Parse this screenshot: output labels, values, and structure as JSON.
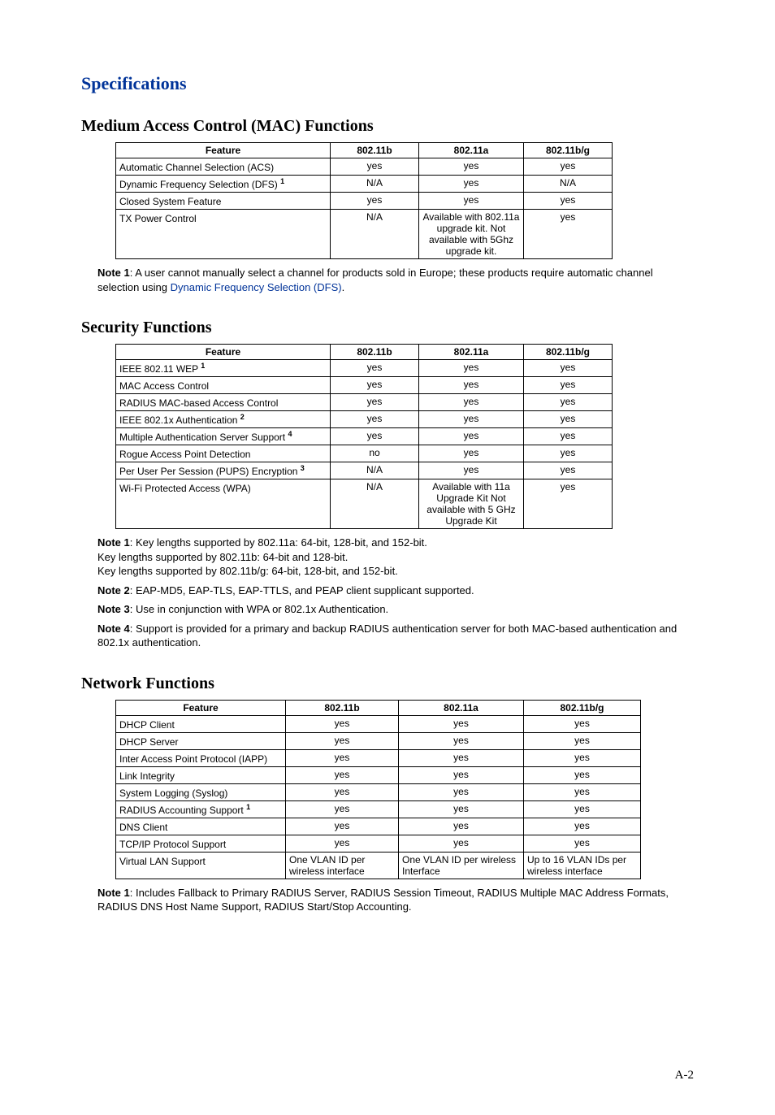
{
  "page_number": "A-2",
  "section_title": "Specifications",
  "sec1": {
    "title": "Medium Access Control (MAC) Functions",
    "headers": {
      "c0": "Feature",
      "c1": "802.11b",
      "c2": "802.11a",
      "c3": "802.11b/g"
    },
    "rows": [
      {
        "f": "Automatic Channel Selection (ACS)",
        "sup": "",
        "b": "yes",
        "a": "yes",
        "bg": "yes"
      },
      {
        "f": "Dynamic Frequency Selection (DFS) ",
        "sup": "1",
        "b": "N/A",
        "a": "yes",
        "bg": "N/A"
      },
      {
        "f": "Closed System Feature",
        "sup": "",
        "b": "yes",
        "a": "yes",
        "bg": "yes"
      },
      {
        "f": "TX Power Control",
        "sup": "",
        "b": "N/A",
        "a": "Available with 802.11a upgrade kit. Not available with 5Ghz upgrade kit.",
        "bg": "yes"
      }
    ],
    "note1_label": "Note 1",
    "note1_text_a": ": A user cannot manually select a channel for products sold in Europe; these products require automatic channel selection using ",
    "note1_link": "Dynamic Frequency Selection (DFS)",
    "note1_text_b": "."
  },
  "sec2": {
    "title": "Security Functions",
    "headers": {
      "c0": "Feature",
      "c1": "802.11b",
      "c2": "802.11a",
      "c3": "802.11b/g"
    },
    "rows": [
      {
        "f": "IEEE 802.11 WEP ",
        "sup": "1",
        "b": "yes",
        "a": "yes",
        "bg": "yes"
      },
      {
        "f": "MAC Access Control",
        "sup": "",
        "b": "yes",
        "a": "yes",
        "bg": "yes"
      },
      {
        "f": "RADIUS MAC-based Access Control",
        "sup": "",
        "b": "yes",
        "a": "yes",
        "bg": "yes"
      },
      {
        "f": "IEEE 802.1x Authentication ",
        "sup": "2",
        "b": "yes",
        "a": "yes",
        "bg": "yes"
      },
      {
        "f": "Multiple Authentication Server Support ",
        "sup": "4",
        "b": "yes",
        "a": "yes",
        "bg": "yes"
      },
      {
        "f": "Rogue Access Point Detection",
        "sup": "",
        "b": "no",
        "a": "yes",
        "bg": "yes"
      },
      {
        "f": "Per User Per Session (PUPS) Encryption ",
        "sup": "3",
        "b": "N/A",
        "a": "yes",
        "bg": "yes"
      },
      {
        "f": "Wi-Fi Protected Access (WPA)",
        "sup": "",
        "b": "N/A",
        "a": "Available with 11a Upgrade Kit Not available with 5 GHz Upgrade Kit",
        "bg": "yes"
      }
    ],
    "notes": {
      "n1_label": "Note 1",
      "n1_l1": ": Key lengths supported by 802.11a: 64-bit, 128-bit, and 152-bit.",
      "n1_l2": "Key lengths supported by 802.11b: 64-bit and 128-bit.",
      "n1_l3": "Key lengths supported by 802.11b/g: 64-bit, 128-bit, and 152-bit.",
      "n2_label": "Note 2",
      "n2_text": ": EAP-MD5, EAP-TLS, EAP-TTLS, and PEAP client supplicant supported.",
      "n3_label": "Note 3",
      "n3_text": ": Use in conjunction with WPA or 802.1x Authentication.",
      "n4_label": "Note 4",
      "n4_text": ": Support is provided for a primary and backup RADIUS authentication server for both MAC-based authentication and 802.1x authentication."
    }
  },
  "sec3": {
    "title": "Network Functions",
    "headers": {
      "c0": "Feature",
      "c1": "802.11b",
      "c2": "802.11a",
      "c3": "802.11b/g"
    },
    "rows": [
      {
        "f": "DHCP Client",
        "sup": "",
        "b": "yes",
        "a": "yes",
        "bg": "yes",
        "align": "c"
      },
      {
        "f": "DHCP Server",
        "sup": "",
        "b": "yes",
        "a": "yes",
        "bg": "yes",
        "align": "c"
      },
      {
        "f": "Inter Access Point Protocol (IAPP)",
        "sup": "",
        "b": "yes",
        "a": "yes",
        "bg": "yes",
        "align": "c"
      },
      {
        "f": "Link Integrity",
        "sup": "",
        "b": "yes",
        "a": "yes",
        "bg": "yes",
        "align": "c"
      },
      {
        "f": "System Logging (Syslog)",
        "sup": "",
        "b": "yes",
        "a": "yes",
        "bg": "yes",
        "align": "c"
      },
      {
        "f": "RADIUS Accounting Support ",
        "sup": "1",
        "b": "yes",
        "a": "yes",
        "bg": "yes",
        "align": "c"
      },
      {
        "f": "DNS Client",
        "sup": "",
        "b": "yes",
        "a": "yes",
        "bg": "yes",
        "align": "c"
      },
      {
        "f": "TCP/IP Protocol Support",
        "sup": "",
        "b": "yes",
        "a": "yes",
        "bg": "yes",
        "align": "c"
      },
      {
        "f": "Virtual LAN Support",
        "sup": "",
        "b": "One VLAN ID per wireless interface",
        "a": "One VLAN ID per wireless Interface",
        "bg": "Up to 16 VLAN IDs per wireless interface",
        "align": "l"
      }
    ],
    "note1_label": "Note 1",
    "note1_text": ": Includes Fallback to Primary RADIUS Server, RADIUS Session Timeout, RADIUS Multiple MAC Address Formats, RADIUS DNS Host Name Support, RADIUS Start/Stop Accounting."
  }
}
